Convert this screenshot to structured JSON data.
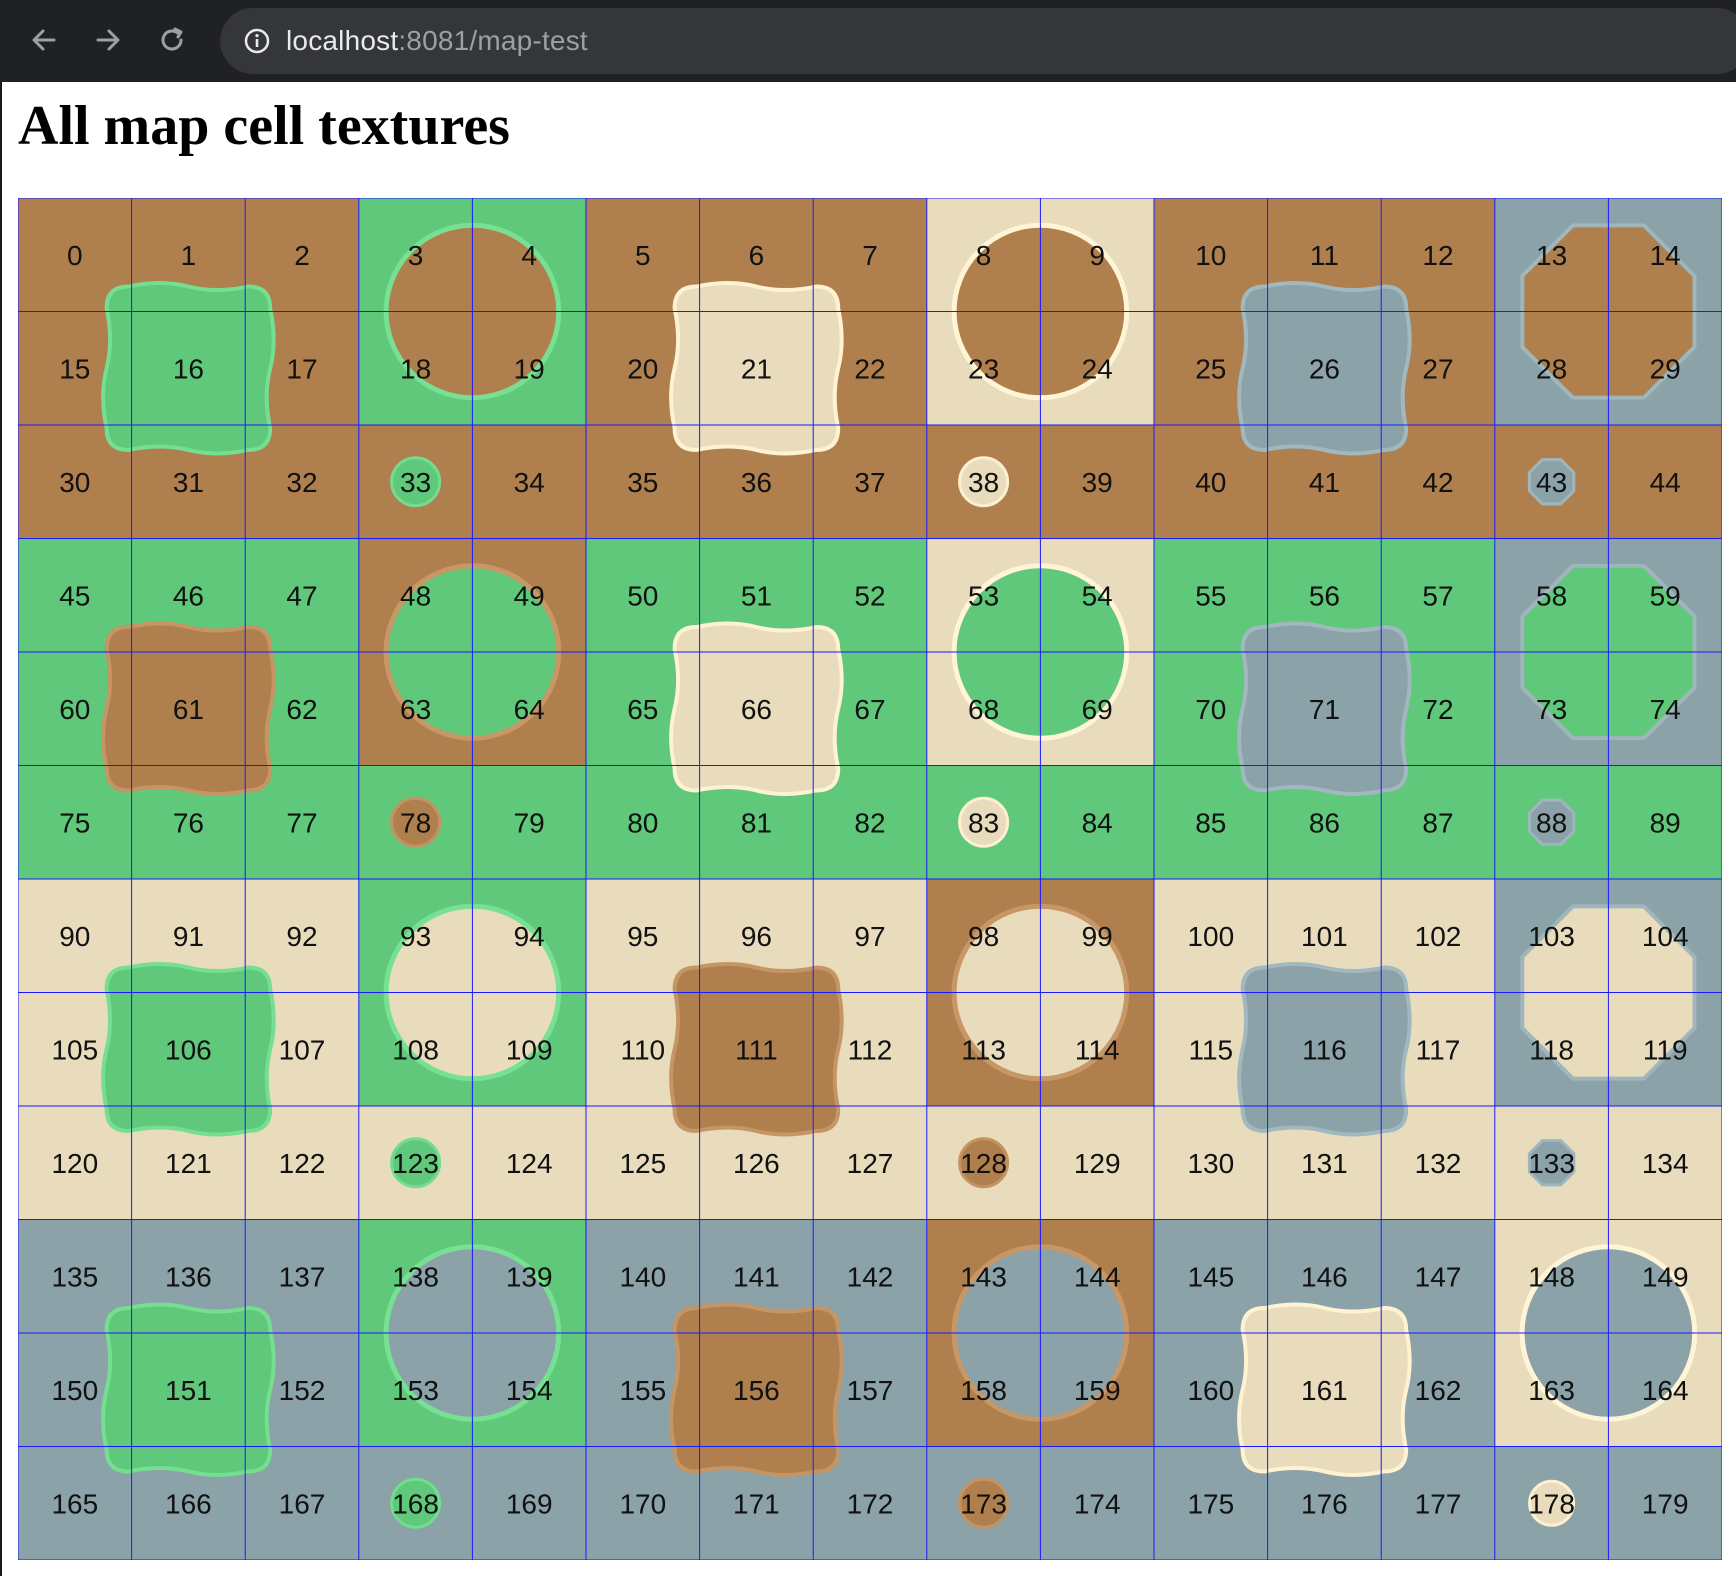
{
  "browser": {
    "url_host": "localhost",
    "url_rest": ":8081/map-test",
    "icons": {
      "back": "arrow-left-icon",
      "forward": "arrow-right-icon",
      "reload": "reload-icon",
      "info": "info-icon"
    }
  },
  "page": {
    "title": "All map cell textures"
  },
  "map": {
    "columns": 15,
    "rows": 12,
    "colors": {
      "dirt": "#b07f4e",
      "grass": "#5fc87a",
      "sand": "#e8dcbd",
      "stone": "#8aa2a8",
      "grid": "#1a1aff"
    },
    "row_base_textures": [
      "dirt",
      "dirt",
      "dirt",
      "grass",
      "grass",
      "grass",
      "sand",
      "sand",
      "sand",
      "stone",
      "stone",
      "stone"
    ],
    "cell_labels": [
      "0",
      "1",
      "2",
      "3",
      "4",
      "5",
      "6",
      "7",
      "8",
      "9",
      "10",
      "11",
      "12",
      "13",
      "14",
      "15",
      "16",
      "17",
      "18",
      "19",
      "20",
      "21",
      "22",
      "23",
      "24",
      "25",
      "26",
      "27",
      "28",
      "29",
      "30",
      "31",
      "32",
      "33",
      "34",
      "35",
      "36",
      "37",
      "38",
      "39",
      "40",
      "41",
      "42",
      "43",
      "44",
      "45",
      "46",
      "47",
      "48",
      "49",
      "50",
      "51",
      "52",
      "53",
      "54",
      "55",
      "56",
      "57",
      "58",
      "59",
      "60",
      "61",
      "62",
      "63",
      "64",
      "65",
      "66",
      "67",
      "68",
      "69",
      "70",
      "71",
      "72",
      "73",
      "74",
      "75",
      "76",
      "77",
      "78",
      "79",
      "80",
      "81",
      "82",
      "83",
      "84",
      "85",
      "86",
      "87",
      "88",
      "89",
      "90",
      "91",
      "92",
      "93",
      "94",
      "95",
      "96",
      "97",
      "98",
      "99",
      "100",
      "101",
      "102",
      "103",
      "104",
      "105",
      "106",
      "107",
      "108",
      "109",
      "110",
      "111",
      "112",
      "113",
      "114",
      "115",
      "116",
      "117",
      "118",
      "119",
      "120",
      "121",
      "122",
      "123",
      "124",
      "125",
      "126",
      "127",
      "128",
      "129",
      "130",
      "131",
      "132",
      "133",
      "134",
      "135",
      "136",
      "137",
      "138",
      "139",
      "140",
      "141",
      "142",
      "143",
      "144",
      "145",
      "146",
      "147",
      "148",
      "149",
      "150",
      "151",
      "152",
      "153",
      "154",
      "155",
      "156",
      "157",
      "158",
      "159",
      "160",
      "161",
      "162",
      "163",
      "164",
      "165",
      "166",
      "167",
      "168",
      "169",
      "170",
      "171",
      "172",
      "173",
      "174",
      "175",
      "176",
      "177",
      "178",
      "179"
    ],
    "blocks": [
      {
        "base": "dirt",
        "patterns": [
          {
            "kind": "blob",
            "texture": "grass"
          },
          {
            "kind": "frame-circle",
            "frame": "grass"
          },
          {
            "kind": "blob",
            "texture": "sand"
          },
          {
            "kind": "frame-circle",
            "frame": "sand"
          },
          {
            "kind": "blob",
            "texture": "stone"
          },
          {
            "kind": "frame-octagon",
            "frame": "stone"
          }
        ],
        "dots": [
          "grass",
          "sand",
          "stone"
        ]
      },
      {
        "base": "grass",
        "patterns": [
          {
            "kind": "blob",
            "texture": "dirt"
          },
          {
            "kind": "frame-circle",
            "frame": "dirt"
          },
          {
            "kind": "blob",
            "texture": "sand"
          },
          {
            "kind": "frame-circle",
            "frame": "sand"
          },
          {
            "kind": "blob",
            "texture": "stone"
          },
          {
            "kind": "frame-octagon",
            "frame": "stone"
          }
        ],
        "dots": [
          "dirt",
          "sand",
          "stone"
        ]
      },
      {
        "base": "sand",
        "patterns": [
          {
            "kind": "blob",
            "texture": "grass"
          },
          {
            "kind": "frame-circle",
            "frame": "grass"
          },
          {
            "kind": "blob",
            "texture": "dirt"
          },
          {
            "kind": "frame-circle",
            "frame": "dirt"
          },
          {
            "kind": "blob",
            "texture": "stone"
          },
          {
            "kind": "frame-octagon",
            "frame": "stone"
          }
        ],
        "dots": [
          "grass",
          "dirt",
          "stone"
        ]
      },
      {
        "base": "stone",
        "patterns": [
          {
            "kind": "blob",
            "texture": "grass"
          },
          {
            "kind": "frame-circle",
            "frame": "grass"
          },
          {
            "kind": "blob",
            "texture": "dirt"
          },
          {
            "kind": "frame-circle",
            "frame": "dirt"
          },
          {
            "kind": "blob",
            "texture": "sand"
          },
          {
            "kind": "frame-circle",
            "frame": "sand"
          }
        ],
        "dots": [
          "grass",
          "dirt",
          "sand"
        ]
      }
    ]
  }
}
